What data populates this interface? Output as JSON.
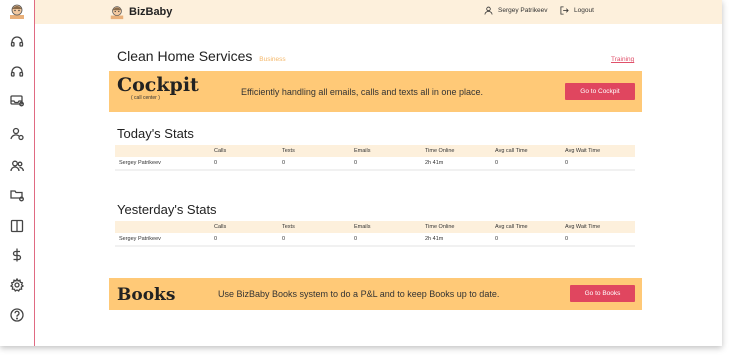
{
  "app": {
    "brand": "BizBaby",
    "user_name": "Sergey Patrikeev",
    "logout_label": "Logout"
  },
  "sidebar": {
    "items": [
      {
        "icon": "baby-logo-icon"
      },
      {
        "icon": "headset-icon"
      },
      {
        "icon": "headset-icon"
      },
      {
        "icon": "inbox-settings-icon"
      },
      {
        "icon": "user-settings-icon"
      },
      {
        "icon": "users-icon"
      },
      {
        "icon": "folder-settings-icon"
      },
      {
        "icon": "book-icon"
      },
      {
        "icon": "dollar-icon"
      },
      {
        "icon": "gear-icon"
      },
      {
        "icon": "help-icon"
      }
    ]
  },
  "page": {
    "company": "Clean Home Services",
    "company_tag": "Business",
    "training_link": "Training"
  },
  "cockpit": {
    "title": "Cockpit",
    "subtitle": "( call center )",
    "description": "Efficiently handling all emails, calls and texts all in one place.",
    "button": "Go to Cockpit"
  },
  "today": {
    "title": "Today's Stats",
    "columns": [
      "",
      "Calls",
      "Texts",
      "Emails",
      "Time Online",
      "Avg call Time",
      "Avg Wait Time"
    ],
    "rows": [
      [
        "Sergey Patrikeev",
        "0",
        "0",
        "0",
        "2h 41m",
        "0",
        "0"
      ]
    ]
  },
  "yesterday": {
    "title": "Yesterday's Stats",
    "columns": [
      "",
      "Calls",
      "Texts",
      "Emails",
      "Time Online",
      "Avg call Time",
      "Avg Wait Time"
    ],
    "rows": [
      [
        "Sergey Patrikeev",
        "0",
        "0",
        "0",
        "2h 41m",
        "0",
        "0"
      ]
    ]
  },
  "books": {
    "title": "Books",
    "description": "Use BizBaby Books system to do a P&L and to keep Books up to date.",
    "button": "Go to Books"
  },
  "colors": {
    "accent": "#e0465f",
    "banner": "#ffc977",
    "topbar": "#fdf0dc"
  }
}
